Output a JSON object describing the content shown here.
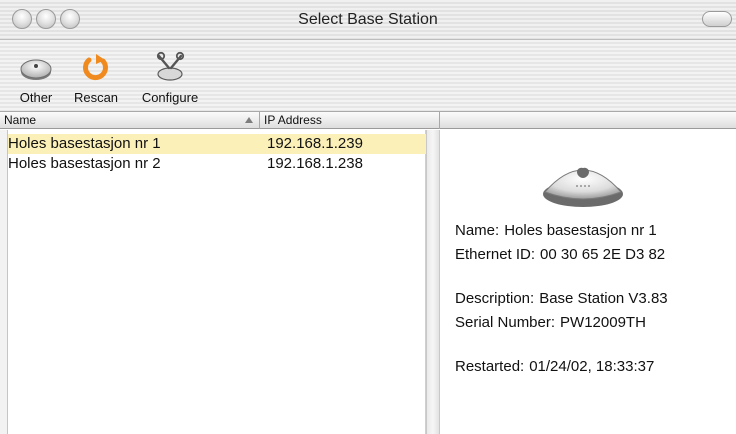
{
  "window": {
    "title": "Select Base Station"
  },
  "toolbar": {
    "other_label": "Other",
    "rescan_label": "Rescan",
    "configure_label": "Configure"
  },
  "table": {
    "columns": {
      "name": "Name",
      "ip": "IP Address"
    },
    "rows": [
      {
        "name": "Holes basestasjon nr 1",
        "ip": "192.168.1.239",
        "selected": true
      },
      {
        "name": "Holes basestasjon nr 2",
        "ip": "192.168.1.238",
        "selected": false
      }
    ]
  },
  "detail": {
    "name_label": "Name:",
    "name_value": "Holes basestasjon nr 1",
    "ethernet_label": "Ethernet ID:",
    "ethernet_value": "00 30 65 2E D3 82",
    "description_label": "Description:",
    "description_value": "Base Station V3.83",
    "serial_label": "Serial Number:",
    "serial_value": "PW12009TH",
    "restarted_label": "Restarted:",
    "restarted_value": "01/24/02, 18:33:37"
  },
  "icons": {
    "other": "base-station-icon",
    "rescan": "refresh-icon",
    "configure": "configure-tools-icon"
  },
  "colors": {
    "selection": "#fbf0b8",
    "rescan_orange": "#f08a1e"
  }
}
